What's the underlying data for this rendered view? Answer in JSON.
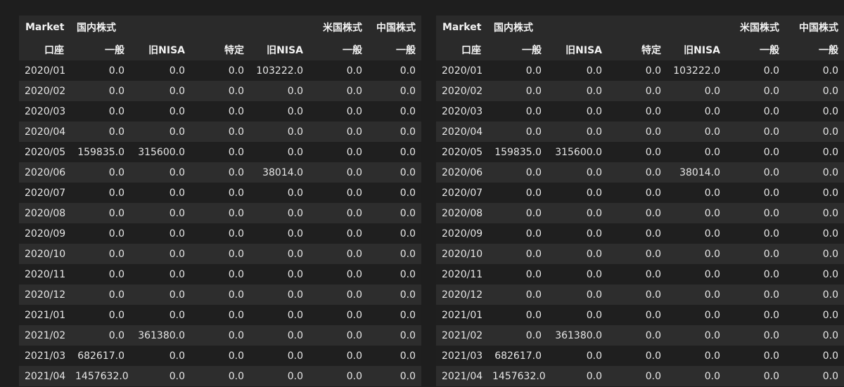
{
  "header": {
    "level0_name": "Market",
    "level1_name": "口座",
    "groups": [
      {
        "label": "国内株式",
        "span": 2,
        "align": "left"
      },
      {
        "label": "米国株式",
        "span": 3,
        "align": "right"
      },
      {
        "label": "中国株式",
        "span": 2,
        "align": "right"
      }
    ],
    "subcolumns": [
      "一般",
      "旧NISA",
      "特定",
      "旧NISA",
      "一般",
      "一般"
    ]
  },
  "rows": [
    {
      "date": "2020/01",
      "values": [
        "0.0",
        "0.0",
        "0.0",
        "103222.0",
        "0.0",
        "0.0"
      ]
    },
    {
      "date": "2020/02",
      "values": [
        "0.0",
        "0.0",
        "0.0",
        "0.0",
        "0.0",
        "0.0"
      ]
    },
    {
      "date": "2020/03",
      "values": [
        "0.0",
        "0.0",
        "0.0",
        "0.0",
        "0.0",
        "0.0"
      ]
    },
    {
      "date": "2020/04",
      "values": [
        "0.0",
        "0.0",
        "0.0",
        "0.0",
        "0.0",
        "0.0"
      ]
    },
    {
      "date": "2020/05",
      "values": [
        "159835.0",
        "315600.0",
        "0.0",
        "0.0",
        "0.0",
        "0.0"
      ]
    },
    {
      "date": "2020/06",
      "values": [
        "0.0",
        "0.0",
        "0.0",
        "38014.0",
        "0.0",
        "0.0"
      ]
    },
    {
      "date": "2020/07",
      "values": [
        "0.0",
        "0.0",
        "0.0",
        "0.0",
        "0.0",
        "0.0"
      ]
    },
    {
      "date": "2020/08",
      "values": [
        "0.0",
        "0.0",
        "0.0",
        "0.0",
        "0.0",
        "0.0"
      ]
    },
    {
      "date": "2020/09",
      "values": [
        "0.0",
        "0.0",
        "0.0",
        "0.0",
        "0.0",
        "0.0"
      ]
    },
    {
      "date": "2020/10",
      "values": [
        "0.0",
        "0.0",
        "0.0",
        "0.0",
        "0.0",
        "0.0"
      ]
    },
    {
      "date": "2020/11",
      "values": [
        "0.0",
        "0.0",
        "0.0",
        "0.0",
        "0.0",
        "0.0"
      ]
    },
    {
      "date": "2020/12",
      "values": [
        "0.0",
        "0.0",
        "0.0",
        "0.0",
        "0.0",
        "0.0"
      ]
    },
    {
      "date": "2021/01",
      "values": [
        "0.0",
        "0.0",
        "0.0",
        "0.0",
        "0.0",
        "0.0"
      ]
    },
    {
      "date": "2021/02",
      "values": [
        "0.0",
        "361380.0",
        "0.0",
        "0.0",
        "0.0",
        "0.0"
      ]
    },
    {
      "date": "2021/03",
      "values": [
        "682617.0",
        "0.0",
        "0.0",
        "0.0",
        "0.0",
        "0.0"
      ]
    },
    {
      "date": "2021/04",
      "values": [
        "1457632.0",
        "0.0",
        "0.0",
        "0.0",
        "0.0",
        "0.0"
      ]
    }
  ],
  "colors": {
    "background": "#1e1e1e",
    "header_bg": "#2a2a2a",
    "row_odd": "#1f1f1f",
    "row_even": "#2d2d2d",
    "text": "#e6e6e6"
  }
}
